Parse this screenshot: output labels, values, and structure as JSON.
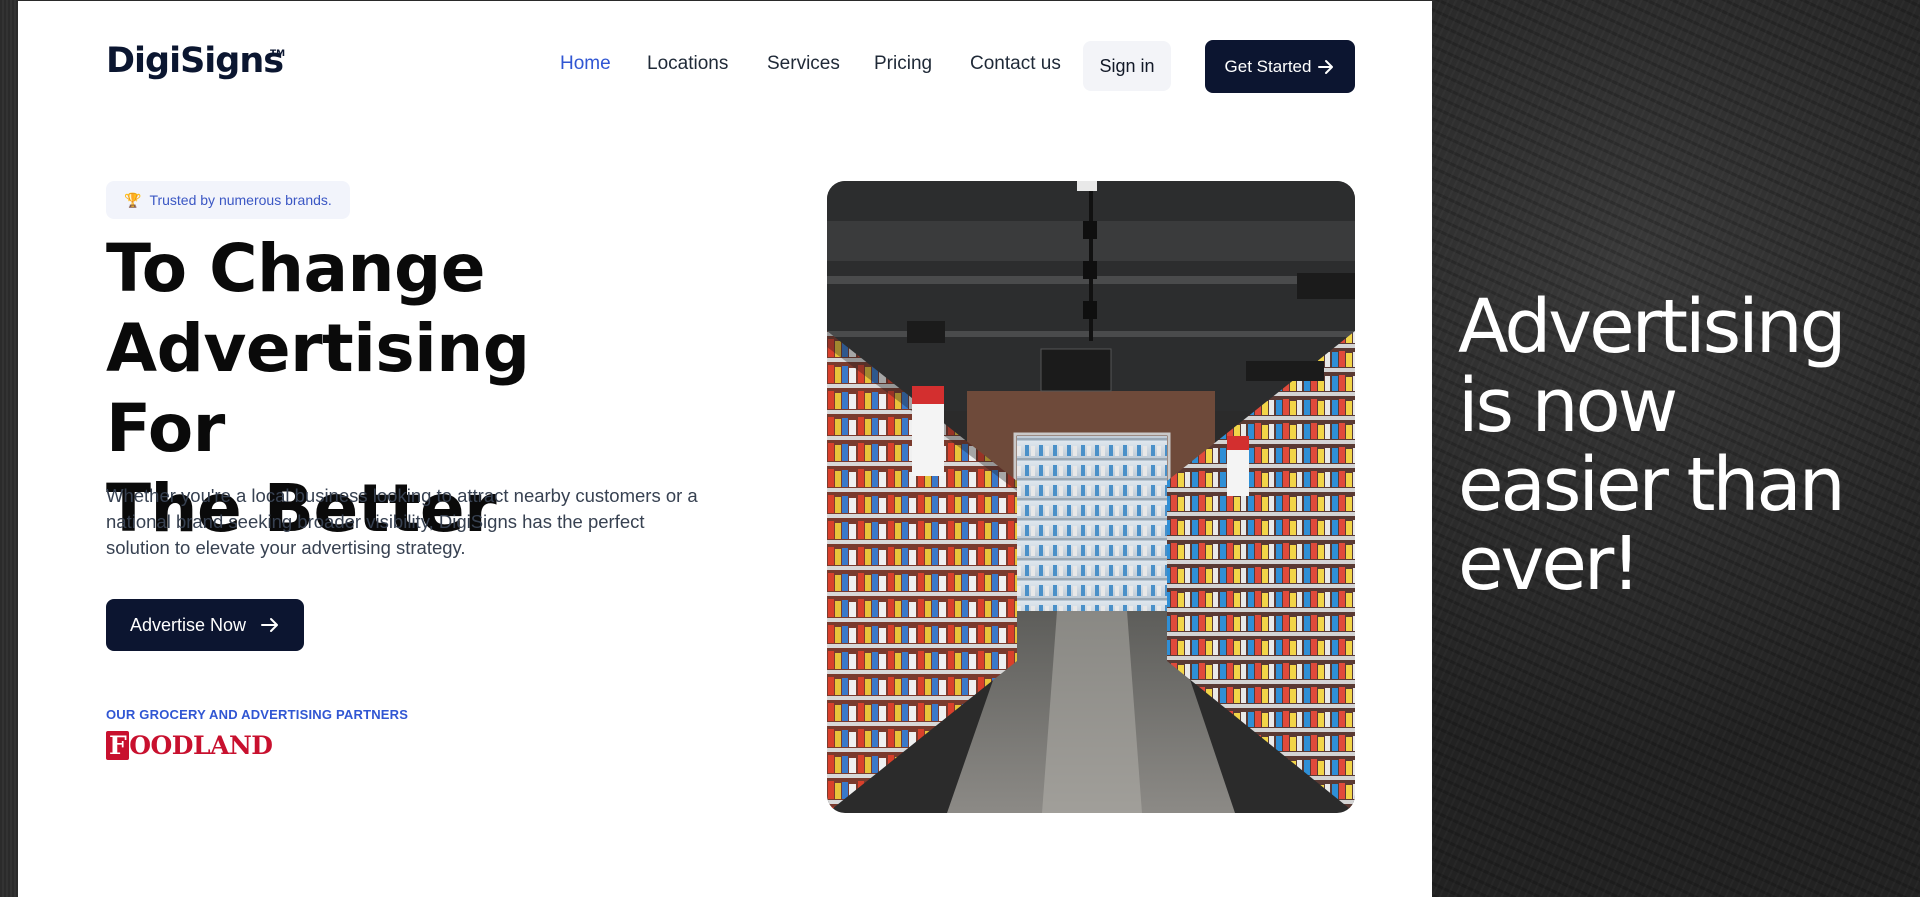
{
  "brand": {
    "name": "DigiSigns",
    "tm": "TM"
  },
  "nav": {
    "items": [
      {
        "label": "Home",
        "active": true
      },
      {
        "label": "Locations",
        "active": false
      },
      {
        "label": "Services",
        "active": false
      },
      {
        "label": "Pricing",
        "active": false
      },
      {
        "label": "Contact us",
        "active": false
      }
    ],
    "sign_in": "Sign in",
    "get_started": "Get Started"
  },
  "hero": {
    "badge": "Trusted by numerous brands.",
    "badge_icon": "trophy-icon",
    "headline": [
      "To Change",
      "Advertising For",
      "The Better"
    ],
    "description": "Whether you're a local business looking to attract nearby customers or a national brand seeking broader visibility, DigiSigns has the perfect solution to elevate your advertising strategy.",
    "cta": "Advertise Now",
    "partners_label": "OUR GROCERY AND ADVERTISING PARTNERS",
    "partner_logo": {
      "first": "F",
      "rest": "OODLAND"
    },
    "image": "grocery-store-aisle-photo"
  },
  "tagline": [
    "Advertising",
    "is now",
    "easier than",
    "ever!"
  ],
  "colors": {
    "primary_dark": "#0c1530",
    "accent_blue": "#3056d3",
    "partner_red": "#c8102e"
  }
}
